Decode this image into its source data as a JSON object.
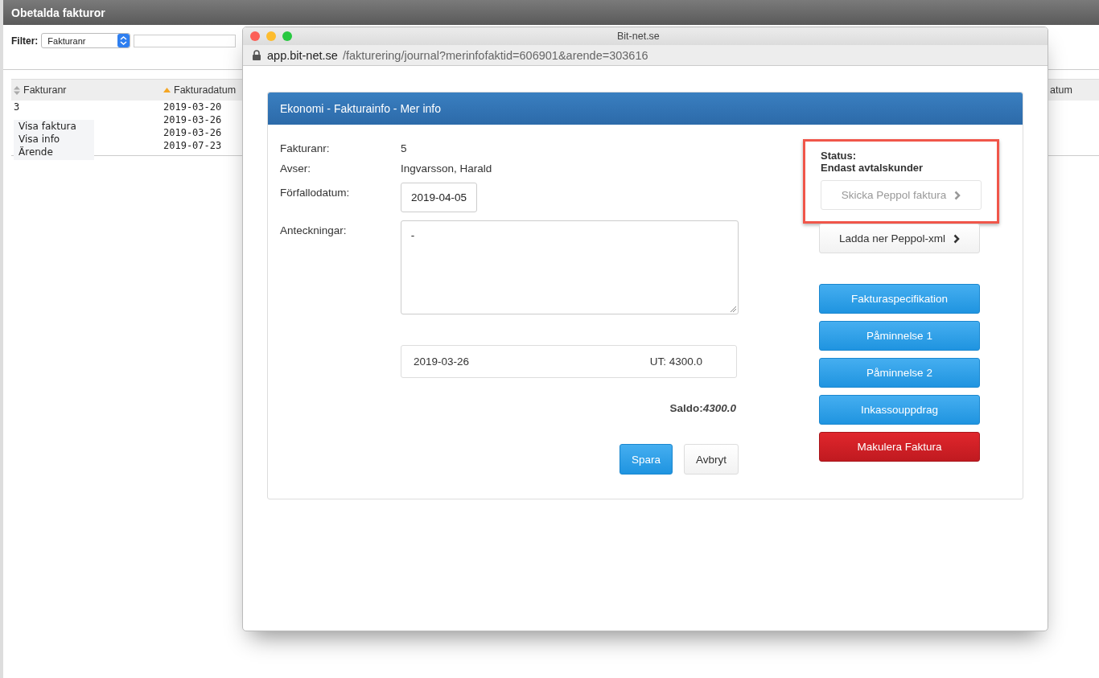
{
  "page": {
    "title": "Obetalda fakturor",
    "filter": {
      "label": "Filter:",
      "select": "Fakturanr"
    },
    "table": {
      "columns": [
        {
          "label": "Fakturanr",
          "sorted": false
        },
        {
          "label": "Fakturadatum",
          "sorted": true
        },
        {
          "label": "atum"
        }
      ],
      "rows": [
        {
          "nr": "3",
          "date": "2019-03-20"
        },
        {
          "date": "2019-03-26"
        },
        {
          "date": "2019-03-26"
        },
        {
          "date": "2019-07-23"
        }
      ]
    },
    "context_menu": [
      "Visa faktura",
      "Visa info",
      "Ärende"
    ]
  },
  "popup": {
    "title": "Bit-net.se",
    "url_host": "app.bit-net.se",
    "url_path": "/fakturering/journal?merinfofaktid=606901&arende=303616",
    "panel_title": "Ekonomi - Fakturainfo - Mer info",
    "fields": [
      {
        "kind": "text",
        "label": "Fakturanr:",
        "value": "5"
      },
      {
        "kind": "text",
        "label": "Avser:",
        "value": "Ingvarsson, Harald"
      },
      {
        "kind": "input",
        "label": "Förfallodatum:",
        "value": "2019-04-05"
      },
      {
        "kind": "textarea",
        "label": "Anteckningar:",
        "value": "-"
      }
    ],
    "transaction": {
      "date": "2019-03-26",
      "amount": "UT: 4300.0"
    },
    "saldo": {
      "label": "Saldo:",
      "value": "4300.0"
    },
    "form_buttons": [
      {
        "label": "Spara",
        "kind": "primary"
      },
      {
        "label": "Avbryt",
        "kind": "default"
      }
    ],
    "status": {
      "highlighted": true,
      "label": "Status:",
      "value": "Endast avtalskunder",
      "button": {
        "label": "Skicka Peppol faktura",
        "disabled": true
      }
    },
    "actions": [
      {
        "label": "Ladda ner Peppol-xml",
        "kind": "default"
      },
      {
        "label": "Fakturaspecifikation",
        "kind": "primary"
      },
      {
        "label": "Påminnelse 1",
        "kind": "primary"
      },
      {
        "label": "Påminnelse 2",
        "kind": "primary"
      },
      {
        "label": "Inkassouppdrag",
        "kind": "primary"
      },
      {
        "label": "Makulera Faktura",
        "kind": "danger"
      }
    ]
  }
}
